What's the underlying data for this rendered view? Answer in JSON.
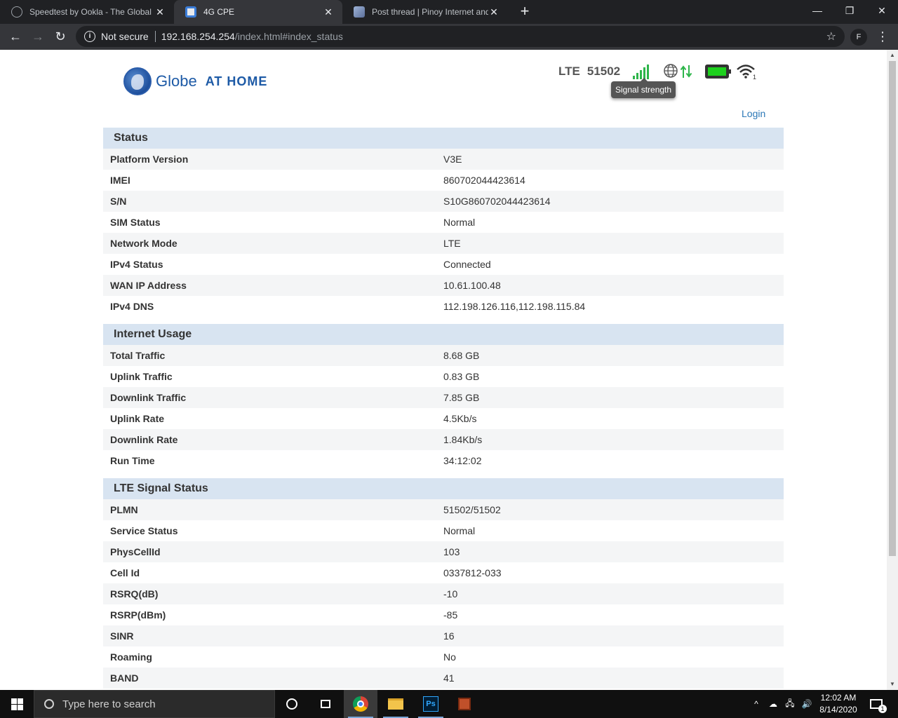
{
  "browser": {
    "tabs": [
      {
        "title": "Speedtest by Ookla - The Global",
        "active": false
      },
      {
        "title": "4G CPE",
        "active": true
      },
      {
        "title": "Post thread | Pinoy Internet and T",
        "active": false
      }
    ],
    "new_tab": "+",
    "security_label": "Not secure",
    "url_host": "192.168.254.254",
    "url_path": "/index.html#index_status",
    "profile_initial": "F"
  },
  "header": {
    "logo_text": "Globe",
    "logo_subtext": "AT HOME",
    "network_type": "LTE",
    "operator": "51502",
    "signal_level": 5,
    "signal_tooltip": "Signal strength",
    "wifi_clients": "1",
    "login_label": "Login"
  },
  "sections": {
    "status": {
      "title": "Status",
      "rows": [
        {
          "label": "Platform Version",
          "value": "V3E"
        },
        {
          "label": "IMEI",
          "value": "860702044423614"
        },
        {
          "label": "S/N",
          "value": "S10G860702044423614"
        },
        {
          "label": "SIM Status",
          "value": "Normal"
        },
        {
          "label": "Network Mode",
          "value": "LTE"
        },
        {
          "label": "IPv4 Status",
          "value": "Connected"
        },
        {
          "label": "WAN IP Address",
          "value": "10.61.100.48"
        },
        {
          "label": "IPv4 DNS",
          "value": "112.198.126.116,112.198.115.84"
        }
      ]
    },
    "usage": {
      "title": "Internet Usage",
      "rows": [
        {
          "label": "Total Traffic",
          "value": "8.68 GB"
        },
        {
          "label": "Uplink Traffic",
          "value": "0.83 GB"
        },
        {
          "label": "Downlink Traffic",
          "value": "7.85 GB"
        },
        {
          "label": "Uplink Rate",
          "value": "4.5Kb/s"
        },
        {
          "label": "Downlink Rate",
          "value": "1.84Kb/s"
        },
        {
          "label": "Run Time",
          "value": "34:12:02"
        }
      ]
    },
    "lte": {
      "title": "LTE Signal Status",
      "rows": [
        {
          "label": "PLMN",
          "value": "51502/51502"
        },
        {
          "label": "Service Status",
          "value": "Normal"
        },
        {
          "label": "PhysCellId",
          "value": "103"
        },
        {
          "label": "Cell Id",
          "value": "0337812-033"
        },
        {
          "label": "RSRQ(dB)",
          "value": "-10"
        },
        {
          "label": "RSRP(dBm)",
          "value": "-85"
        },
        {
          "label": "SINR",
          "value": "16"
        },
        {
          "label": "Roaming",
          "value": "No"
        },
        {
          "label": "BAND",
          "value": "41"
        }
      ]
    }
  },
  "taskbar": {
    "search_placeholder": "Type here to search",
    "time": "12:02 AM",
    "date": "8/14/2020",
    "notification_count": "1"
  },
  "colors": {
    "section_header_bg": "#d8e4f1",
    "signal_green": "#2db54a",
    "battery_green": "#1ed11e",
    "link_blue": "#2b78b7",
    "brand_blue": "#1d5aa6"
  }
}
